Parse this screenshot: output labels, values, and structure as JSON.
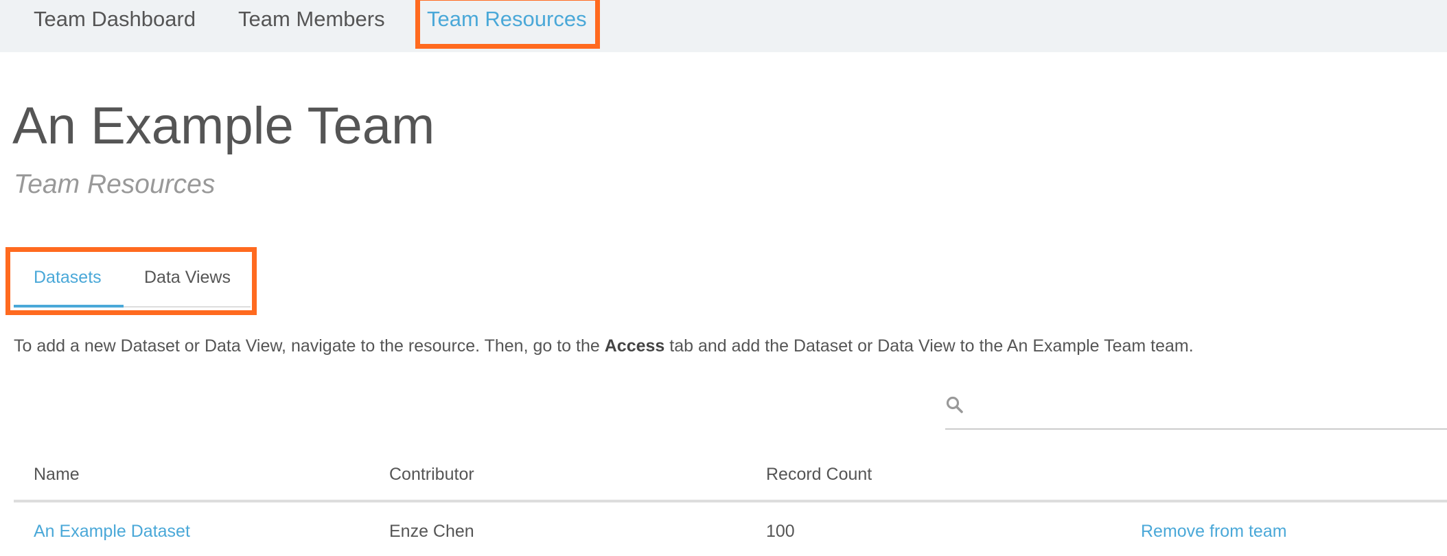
{
  "nav": {
    "items": [
      {
        "label": "Team Dashboard"
      },
      {
        "label": "Team Members"
      },
      {
        "label": "Team Resources"
      }
    ],
    "active_index": 2
  },
  "header": {
    "title": "An Example Team",
    "subtitle": "Team Resources"
  },
  "tabs": {
    "items": [
      {
        "label": "Datasets"
      },
      {
        "label": "Data Views"
      }
    ],
    "active_index": 0
  },
  "help": {
    "before": "To add a new Dataset or Data View, navigate to the resource. Then, go to the ",
    "bold": "Access",
    "after": " tab and add the Dataset or Data View to the An Example Team team."
  },
  "search": {
    "icon": "search-icon",
    "value": "",
    "placeholder": ""
  },
  "table": {
    "headers": {
      "name": "Name",
      "contributor": "Contributor",
      "record_count": "Record Count",
      "action": ""
    },
    "rows": [
      {
        "name": "An Example Dataset",
        "contributor": "Enze Chen",
        "record_count": "100",
        "action": "Remove from team"
      }
    ]
  },
  "colors": {
    "accent": "#4aa8d8",
    "highlight": "#ff6a1f",
    "nav_bg": "#eff2f4"
  }
}
